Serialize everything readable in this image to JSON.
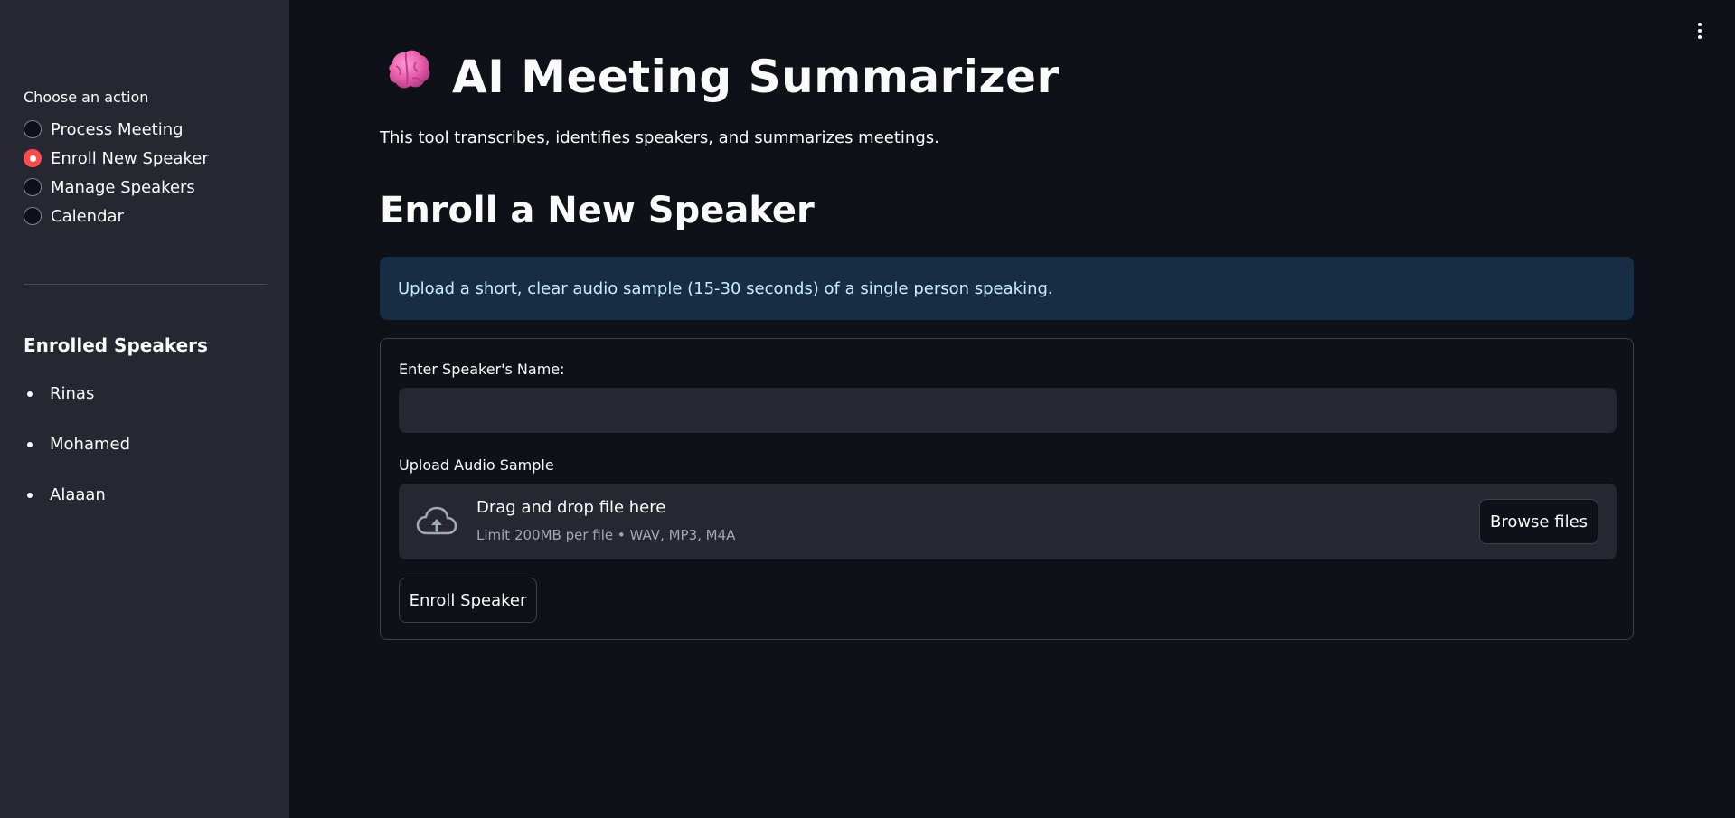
{
  "sidebar": {
    "radio_label": "Choose an action",
    "options": [
      {
        "label": "Process Meeting",
        "selected": false
      },
      {
        "label": "Enroll New Speaker",
        "selected": true
      },
      {
        "label": "Manage Speakers",
        "selected": false
      },
      {
        "label": "Calendar",
        "selected": false
      }
    ],
    "enrolled_heading": "Enrolled Speakers",
    "speakers": [
      "Rinas",
      "Mohamed",
      "Alaaan"
    ]
  },
  "header": {
    "icon": "brain-icon",
    "title": "AI Meeting Summarizer",
    "description": "This tool transcribes, identifies speakers, and summarizes meetings."
  },
  "main": {
    "section_title": "Enroll a New Speaker",
    "info": "Upload a short, clear audio sample (15-30 seconds) of a single person speaking.",
    "form": {
      "name_label": "Enter Speaker's Name:",
      "name_value": "",
      "upload_label": "Upload Audio Sample",
      "dropzone_title": "Drag and drop file here",
      "dropzone_subtitle": "Limit 200MB per file • WAV, MP3, M4A",
      "browse_label": "Browse files",
      "submit_label": "Enroll Speaker"
    }
  },
  "colors": {
    "accent": "#ff4b4b",
    "background": "#0e1117",
    "sidebar": "#262730",
    "info_bg": "#172d43",
    "info_text": "#c7ebff"
  }
}
